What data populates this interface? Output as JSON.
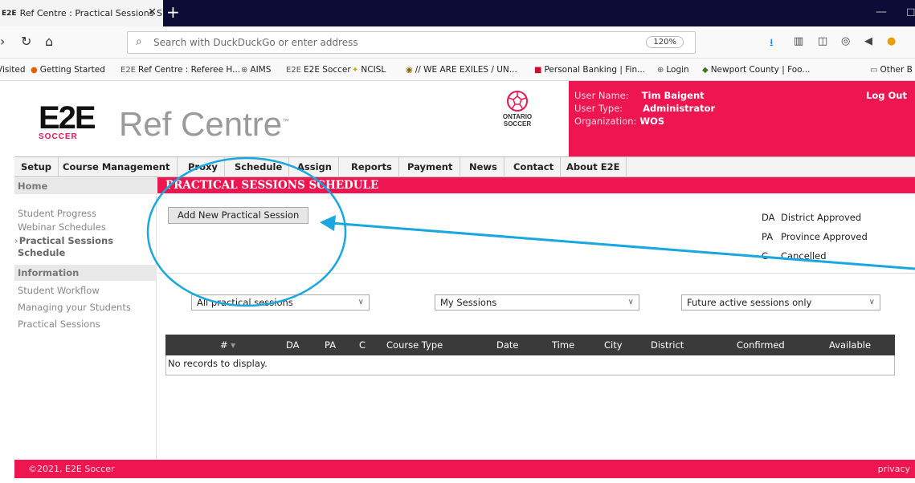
{
  "browser": {
    "tab_title": "Ref Centre : Practical Sessions S",
    "tab_favicon": "E2E",
    "new_tab_glyph": "+",
    "url_placeholder": "Search with DuckDuckGo or enter address",
    "zoom": "120%"
  },
  "bookmarks": [
    {
      "label": "Visited",
      "icon": "none"
    },
    {
      "label": "Getting Started",
      "icon": "firefox-icon"
    },
    {
      "label": "Ref Centre : Referee H...",
      "icon": "e2e-icon"
    },
    {
      "label": "AIMS",
      "icon": "globe-icon"
    },
    {
      "label": "E2E Soccer",
      "icon": "e2e-icon"
    },
    {
      "label": "NCISL",
      "icon": "ncisl-icon"
    },
    {
      "label": "// WE ARE EXILES / UN...",
      "icon": "exiles-icon"
    },
    {
      "label": "Personal Banking | Fin...",
      "icon": "bank-icon"
    },
    {
      "label": "Login",
      "icon": "globe-icon"
    },
    {
      "label": "Newport County | Foo...",
      "icon": "shield-icon"
    },
    {
      "label": "Other B",
      "icon": "folder-icon"
    }
  ],
  "header": {
    "logo_mark": "E2E",
    "logo_soccer": "SOCCER",
    "logo_title": "Ref Centre",
    "logo_tm": "™",
    "ontario_line1": "ONTARIO",
    "ontario_line2": "SOCCER"
  },
  "user": {
    "name_label": "User Name:",
    "name_value": "Tim Baigent",
    "type_label": "User Type:",
    "type_value": "Administrator",
    "org_label": "Organization:",
    "org_value": "WOS",
    "logout": "Log Out"
  },
  "menu": [
    "Setup",
    "Course Management",
    "Proxy",
    "Schedule",
    "Assign",
    "Reports",
    "Payment",
    "News",
    "Contact",
    "About E2E"
  ],
  "sidebar": {
    "home": "Home",
    "links1": [
      "Student Progress",
      "Webinar Schedules"
    ],
    "active_line1": "Practical Sessions",
    "active_line2": "Schedule",
    "info_head": "Information",
    "links2": [
      "Student Workflow",
      "Managing your Students",
      "Practical Sessions"
    ]
  },
  "main": {
    "title": "PRACTICAL SESSIONS SCHEDULE",
    "add_button": "Add New Practical Session",
    "legend": [
      {
        "abbr": "DA",
        "text": "District Approved"
      },
      {
        "abbr": "PA",
        "text": "Province Approved"
      },
      {
        "abbr": "C",
        "text": "Cancelled"
      }
    ],
    "filters": {
      "sessions": "All practical sessions",
      "owner": "My Sessions",
      "timeframe": "Future active sessions only"
    },
    "grid_columns": [
      "#",
      "DA",
      "PA",
      "C",
      "Course Type",
      "Date",
      "Time",
      "City",
      "District",
      "Confirmed",
      "Available"
    ],
    "empty_text": "No records to display."
  },
  "footer": {
    "copyright": "©2021, E2E Soccer",
    "privacy": "privacy"
  },
  "colors": {
    "brand_red": "#ed1651",
    "annotation_blue": "#1aa7e0",
    "grid_header": "#3a3a3a"
  }
}
